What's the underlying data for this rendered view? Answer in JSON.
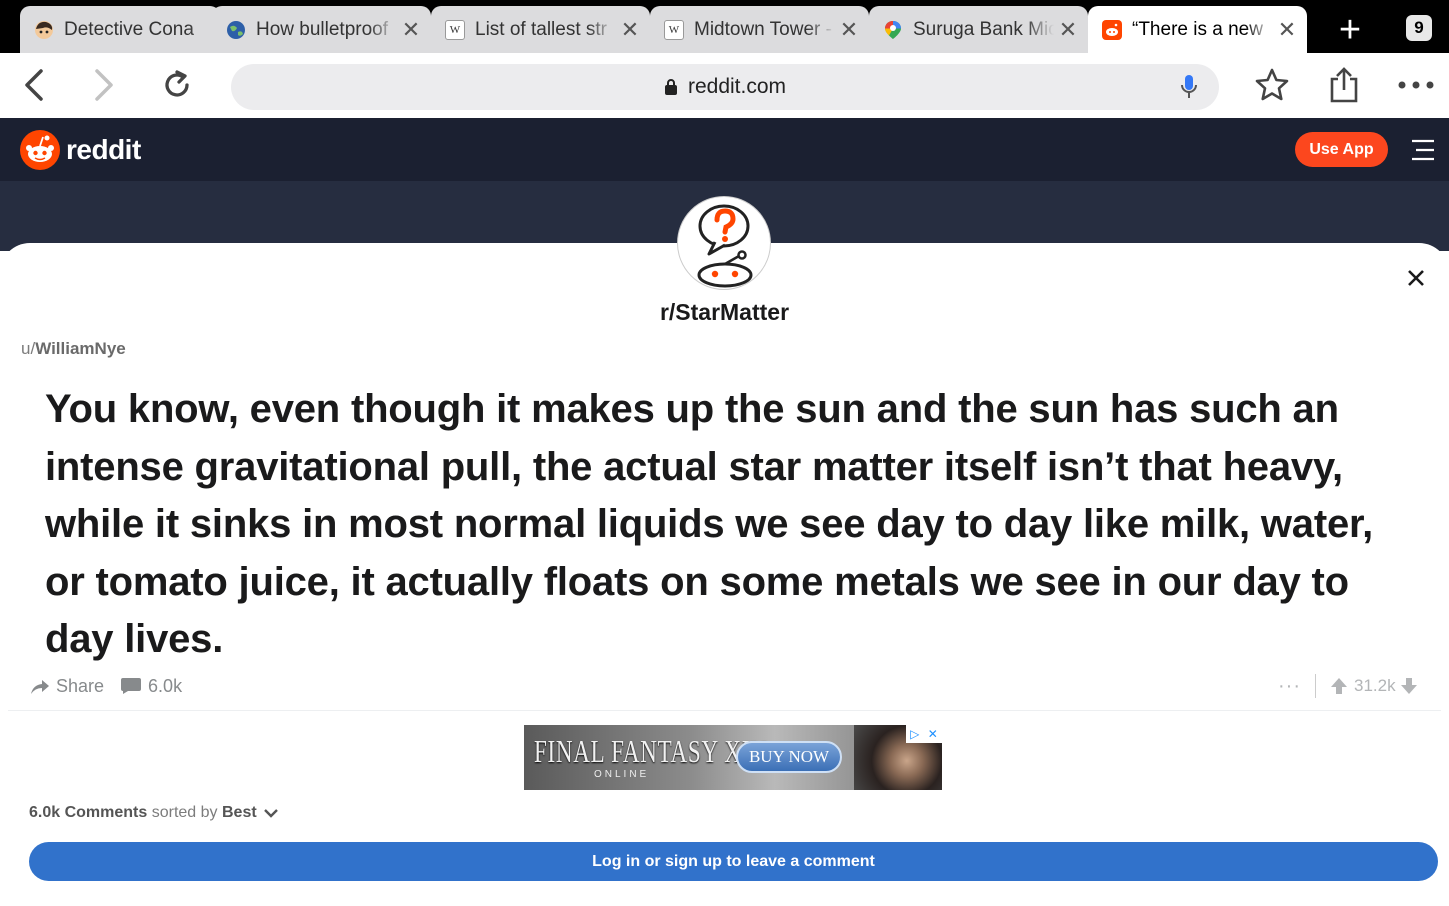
{
  "browser": {
    "tabs": [
      {
        "title": "Detective Cona",
        "icon": "anime-character-icon",
        "active": false,
        "close": false
      },
      {
        "title": "How bulletproof",
        "icon": "globe-icon",
        "active": false,
        "close": true
      },
      {
        "title": "List of tallest str",
        "icon": "wikipedia-icon",
        "fav_text": "W",
        "active": false,
        "close": true
      },
      {
        "title": "Midtown Tower -",
        "icon": "wikipedia-icon",
        "fav_text": "W",
        "active": false,
        "close": true
      },
      {
        "title": "Suruga Bank Mic",
        "icon": "maps-pin-icon",
        "active": false,
        "close": true
      },
      {
        "title": "“There is a new",
        "icon": "reddit-icon",
        "active": true,
        "close": true
      }
    ],
    "tab_count": "9",
    "url": "reddit.com"
  },
  "header": {
    "logo_text": "reddit",
    "use_app_label": "Use App"
  },
  "post": {
    "subreddit": "r/StarMatter",
    "author_prefix": "u/",
    "author": "WilliamNye",
    "title": "You know, even though it makes up the sun and the sun has such an intense gravitational pull, the actual star matter itself isn’t that heavy, while it sinks in most normal liquids we see day to day like milk, water, or tomato juice, it actually floats on some metals we see in our day to day lives.",
    "share_label": "Share",
    "comment_count": "6.0k",
    "vote_count": "31.2k"
  },
  "ad": {
    "title": "FINAL FANTASY XIV",
    "subtitle": "ONLINE",
    "cta": "BUY NOW"
  },
  "comments": {
    "count_label": "6.0k Comments",
    "sorted_by": "sorted by",
    "sort_value": "Best",
    "login_label": "Log in or sign up to leave a comment"
  },
  "colors": {
    "reddit_orange": "#fc471e",
    "header_bg": "#1b2031",
    "login_blue": "#3172cb"
  }
}
